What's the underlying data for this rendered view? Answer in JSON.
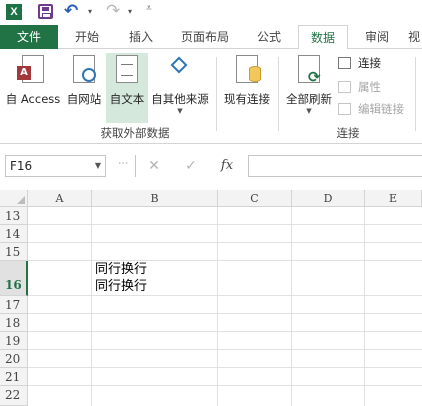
{
  "quick_access": {
    "app_logo": "X",
    "icons": [
      "excel-logo-icon",
      "save-icon",
      "undo-icon",
      "redo-icon",
      "customize-qat-icon"
    ]
  },
  "tabs": [
    {
      "label": "文件"
    },
    {
      "label": "开始"
    },
    {
      "label": "插入"
    },
    {
      "label": "页面布局"
    },
    {
      "label": "公式"
    },
    {
      "label": "数据"
    },
    {
      "label": "审阅"
    },
    {
      "label": "视"
    }
  ],
  "ribbon": {
    "get_external": {
      "from_access": "自 Access",
      "from_web": "自网站",
      "from_text": "自文本",
      "from_other": "自其他来源",
      "group_label": "获取外部数据"
    },
    "existing_connections": "现有连接",
    "connections": {
      "refresh_all": "全部刷新",
      "connections": "连接",
      "properties": "属性",
      "edit_links": "编辑链接",
      "group_label": "连接"
    }
  },
  "formula_bar": {
    "name_box": "F16",
    "cancel": "✕",
    "enter": "✓",
    "fx": "fx",
    "value": ""
  },
  "grid": {
    "columns": [
      "A",
      "B",
      "C",
      "D",
      "E"
    ],
    "rows": [
      "13",
      "14",
      "15",
      "16",
      "17",
      "18",
      "19",
      "20",
      "21",
      "22"
    ],
    "selected_row": "16",
    "cells": {
      "B16_line1": "同行换行",
      "B16_line2": "同行换行"
    }
  },
  "colors": {
    "accent": "#217346",
    "selected_button": "#d5e8dc"
  }
}
